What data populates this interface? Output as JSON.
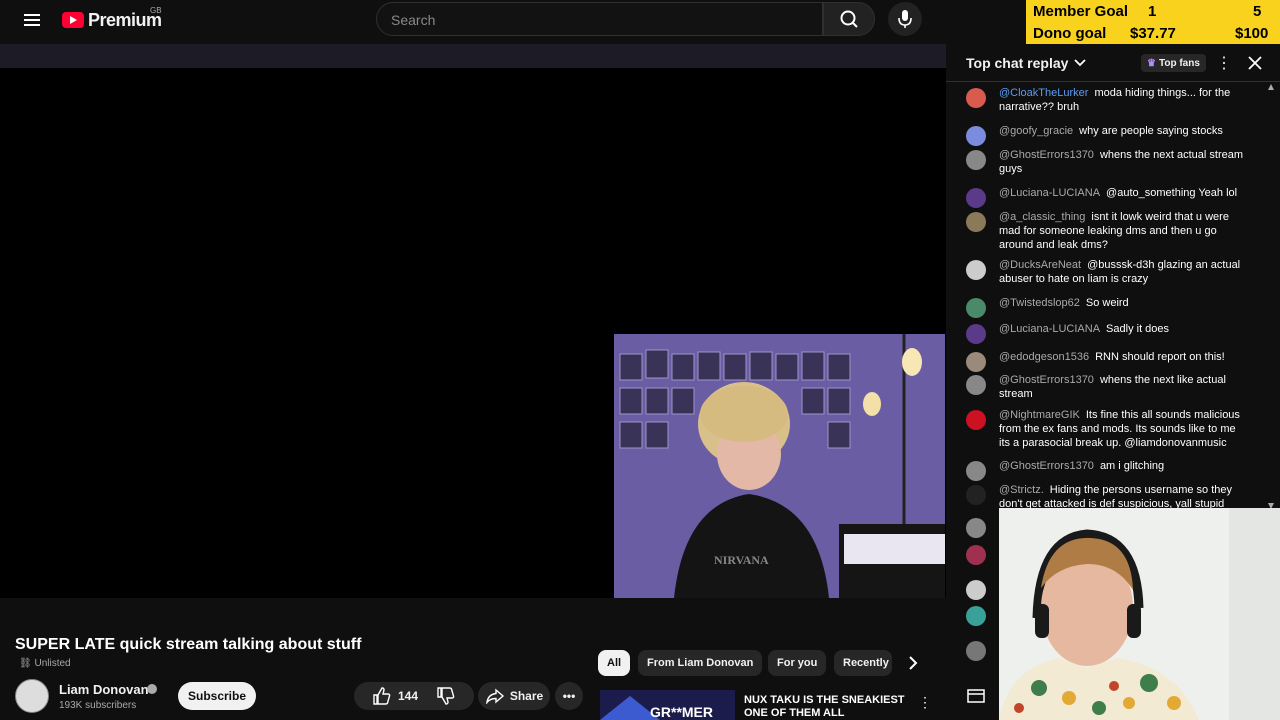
{
  "header": {
    "logo_text": "Premium",
    "logo_region": "GB",
    "search_placeholder": "Search"
  },
  "goal_overlay": {
    "member_label": "Member Goal",
    "member_current": "1",
    "member_target": "5",
    "dono_label": "Dono goal",
    "dono_current": "$37.77",
    "dono_target": "$100"
  },
  "video": {
    "title": "SUPER LATE quick stream talking about stuff",
    "visibility": "Unlisted",
    "channel_name": "Liam Donovan",
    "subscribers": "193K subscribers",
    "subscribe_label": "Subscribe",
    "likes": "144",
    "share_label": "Share"
  },
  "chips": [
    "All",
    "From Liam Donovan",
    "For you",
    "Recently"
  ],
  "next_video": {
    "thumb_text": "GR**MER",
    "title": "NUX TAKU IS THE SNEAKIEST ONE OF THEM ALL"
  },
  "chat": {
    "title": "Top chat replay",
    "top_fans_label": "Top fans",
    "messages": [
      {
        "author": "@CloakTheLurker",
        "text": "moda hiding things... for the narrative?? bruh",
        "color": "#d95b4e"
      },
      {
        "author": "@goofy_gracie",
        "text": "why are people saying stocks",
        "color": "#7b8cde"
      },
      {
        "author": "@GhostErrors1370",
        "text": "whens the next actual stream guys",
        "color": "#888888"
      },
      {
        "author": "@Luciana-LUCIANA",
        "text": "@auto_something Yeah lol",
        "color": "#5b3a8a"
      },
      {
        "author": "@a_classic_thing",
        "text": "isnt it lowk weird that u were mad for someone leaking dms and then u go around and leak dms?",
        "color": "#8a7a5a"
      },
      {
        "author": "@DucksAreNeat",
        "text": "@busssk-d3h glazing an actual abuser to hate on liam is crazy",
        "color": "#cccccc"
      },
      {
        "author": "@Twistedslop62",
        "text": "So weird",
        "color": "#4a8a6a"
      },
      {
        "author": "@Luciana-LUCIANA",
        "text": "Sadly it does",
        "color": "#5b3a8a"
      },
      {
        "author": "@edodgeson1536",
        "text": "RNN should report on this!",
        "color": "#9a8a7a"
      },
      {
        "author": "@GhostErrors1370",
        "text": "whens the next like actual stream",
        "color": "#888888"
      },
      {
        "author": "@NightmareGIK",
        "text": "Its fine this all sounds malicious from the ex fans and mods. Its sounds like to me its a parasocial break up. @liamdonovanmusic",
        "color": "#cc1122"
      },
      {
        "author": "@GhostErrors1370",
        "text": "am i glitching",
        "color": "#888888"
      },
      {
        "author": "@Strictz.",
        "text": "Hiding the persons username so they don't get attacked is def suspicious, yall stupid",
        "color": "#222222"
      }
    ]
  },
  "colors": {
    "goal_bg": "#f8d21c",
    "youtube_red": "#ff0033",
    "page_bg": "#0f0f0f"
  }
}
